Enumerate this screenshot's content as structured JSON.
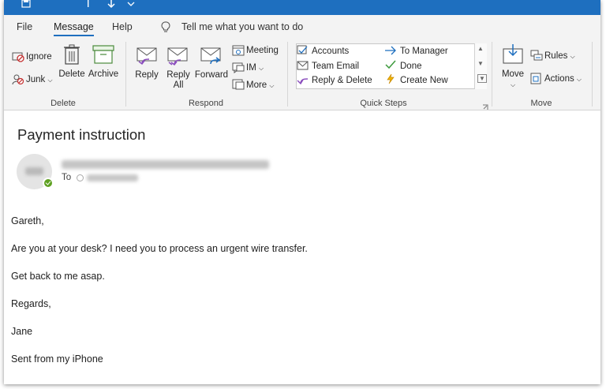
{
  "tabs": {
    "file": "File",
    "message": "Message",
    "help": "Help",
    "tell_me": "Tell me what you want to do"
  },
  "ribbon": {
    "delete_group": {
      "label": "Delete",
      "ignore": "Ignore",
      "junk": "Junk",
      "delete": "Delete",
      "archive": "Archive"
    },
    "respond_group": {
      "label": "Respond",
      "reply": "Reply",
      "reply_all_line1": "Reply",
      "reply_all_line2": "All",
      "forward": "Forward",
      "meeting": "Meeting",
      "im": "IM",
      "more": "More"
    },
    "quick_steps_group": {
      "label": "Quick Steps",
      "items": [
        "Accounts",
        "To Manager",
        "Team Email",
        "Done",
        "Reply & Delete",
        "Create New"
      ]
    },
    "move_group": {
      "label": "Move",
      "move": "Move",
      "rules": "Rules",
      "actions": "Actions"
    }
  },
  "message": {
    "subject": "Payment instruction",
    "to_label": "To",
    "body": [
      "Gareth,",
      "Are you at your desk? I need you to process an urgent wire transfer.",
      "Get back to me asap.",
      "Regards,",
      "Jane",
      "Sent from my iPhone"
    ]
  },
  "colors": {
    "titlebar": "#1e6fbf",
    "ribbon_bg": "#f3f3f3",
    "accent": "#1e6fbf",
    "presence_available": "#5ea021"
  },
  "icons": [
    "save-icon",
    "undo-icon",
    "redo-icon",
    "lightbulb-icon",
    "ignore-icon",
    "junk-icon",
    "trash-icon",
    "archive-icon",
    "reply-icon",
    "reply-all-icon",
    "forward-icon",
    "meeting-icon",
    "im-icon",
    "more-icon",
    "quick-step-icons",
    "move-icon",
    "rules-icon",
    "actions-icon",
    "presence-available-icon"
  ]
}
